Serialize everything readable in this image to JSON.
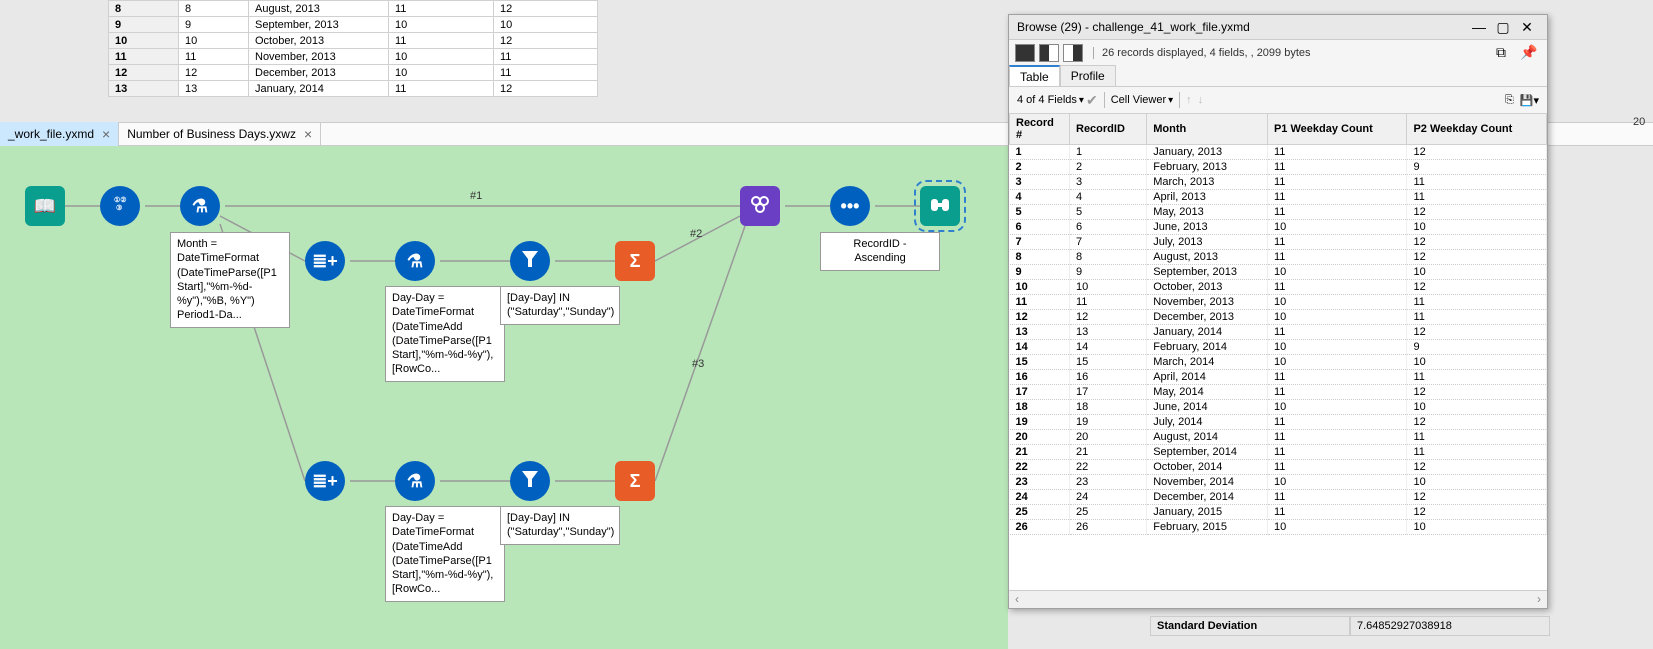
{
  "top_table": {
    "rows": [
      {
        "n": "8",
        "id": "8",
        "month": "August, 2013",
        "p1": "11",
        "p2": "12"
      },
      {
        "n": "9",
        "id": "9",
        "month": "September, 2013",
        "p1": "10",
        "p2": "10"
      },
      {
        "n": "10",
        "id": "10",
        "month": "October, 2013",
        "p1": "11",
        "p2": "12"
      },
      {
        "n": "11",
        "id": "11",
        "month": "November, 2013",
        "p1": "10",
        "p2": "11"
      },
      {
        "n": "12",
        "id": "12",
        "month": "December, 2013",
        "p1": "10",
        "p2": "11"
      },
      {
        "n": "13",
        "id": "13",
        "month": "January, 2014",
        "p1": "11",
        "p2": "12"
      }
    ]
  },
  "tabs": {
    "active": {
      "label": "_work_file.yxmd"
    },
    "other": {
      "label": "Number of Business Days.yxwz"
    }
  },
  "canvas": {
    "formula1_label": "Month = DateTimeFormat (DateTimeParse([P1 Start],\"%m-%d-%y\"),\"%B, %Y\") Period1-Da...",
    "formula2_label": "Day-Day = DateTimeFormat (DateTimeAdd (DateTimeParse([P1 Start],\"%m-%d-%y\"), [RowCo...",
    "formula3_label": "Day-Day = DateTimeFormat (DateTimeAdd (DateTimeParse([P1 Start],\"%m-%d-%y\"), [RowCo...",
    "filter1_label": "[Day-Day] IN (\"Saturday\",\"Sunday\")",
    "filter2_label": "[Day-Day] IN (\"Saturday\",\"Sunday\")",
    "sort_label": "RecordID - Ascending",
    "conn": {
      "c1": "#1",
      "c2": "#2",
      "c3": "#3"
    }
  },
  "browse": {
    "title": "Browse (29) - challenge_41_work_file.yxmd",
    "status": "26 records displayed, 4 fields, , 2099 bytes",
    "tabs": {
      "table": "Table",
      "profile": "Profile"
    },
    "fields_label": "4 of 4 Fields",
    "cell_viewer": "Cell Viewer",
    "columns": [
      "Record #",
      "RecordID",
      "Month",
      "P1 Weekday Count",
      "P2 Weekday Count"
    ],
    "rows": [
      [
        "1",
        "1",
        "January, 2013",
        "11",
        "12"
      ],
      [
        "2",
        "2",
        "February, 2013",
        "11",
        "9"
      ],
      [
        "3",
        "3",
        "March, 2013",
        "11",
        "11"
      ],
      [
        "4",
        "4",
        "April, 2013",
        "11",
        "11"
      ],
      [
        "5",
        "5",
        "May, 2013",
        "11",
        "12"
      ],
      [
        "6",
        "6",
        "June, 2013",
        "10",
        "10"
      ],
      [
        "7",
        "7",
        "July, 2013",
        "11",
        "12"
      ],
      [
        "8",
        "8",
        "August, 2013",
        "11",
        "12"
      ],
      [
        "9",
        "9",
        "September, 2013",
        "10",
        "10"
      ],
      [
        "10",
        "10",
        "October, 2013",
        "11",
        "12"
      ],
      [
        "11",
        "11",
        "November, 2013",
        "10",
        "11"
      ],
      [
        "12",
        "12",
        "December, 2013",
        "10",
        "11"
      ],
      [
        "13",
        "13",
        "January, 2014",
        "11",
        "12"
      ],
      [
        "14",
        "14",
        "February, 2014",
        "10",
        "9"
      ],
      [
        "15",
        "15",
        "March, 2014",
        "10",
        "10"
      ],
      [
        "16",
        "16",
        "April, 2014",
        "11",
        "11"
      ],
      [
        "17",
        "17",
        "May, 2014",
        "11",
        "12"
      ],
      [
        "18",
        "18",
        "June, 2014",
        "10",
        "10"
      ],
      [
        "19",
        "19",
        "July, 2014",
        "11",
        "12"
      ],
      [
        "20",
        "20",
        "August, 2014",
        "11",
        "11"
      ],
      [
        "21",
        "21",
        "September, 2014",
        "11",
        "11"
      ],
      [
        "22",
        "22",
        "October, 2014",
        "11",
        "12"
      ],
      [
        "23",
        "23",
        "November, 2014",
        "10",
        "10"
      ],
      [
        "24",
        "24",
        "December, 2014",
        "11",
        "12"
      ],
      [
        "25",
        "25",
        "January, 2015",
        "11",
        "12"
      ],
      [
        "26",
        "26",
        "February, 2015",
        "10",
        "10"
      ]
    ]
  },
  "stats": {
    "label": "Standard Deviation",
    "value": "7.64852927038918"
  },
  "right_edge": "20"
}
